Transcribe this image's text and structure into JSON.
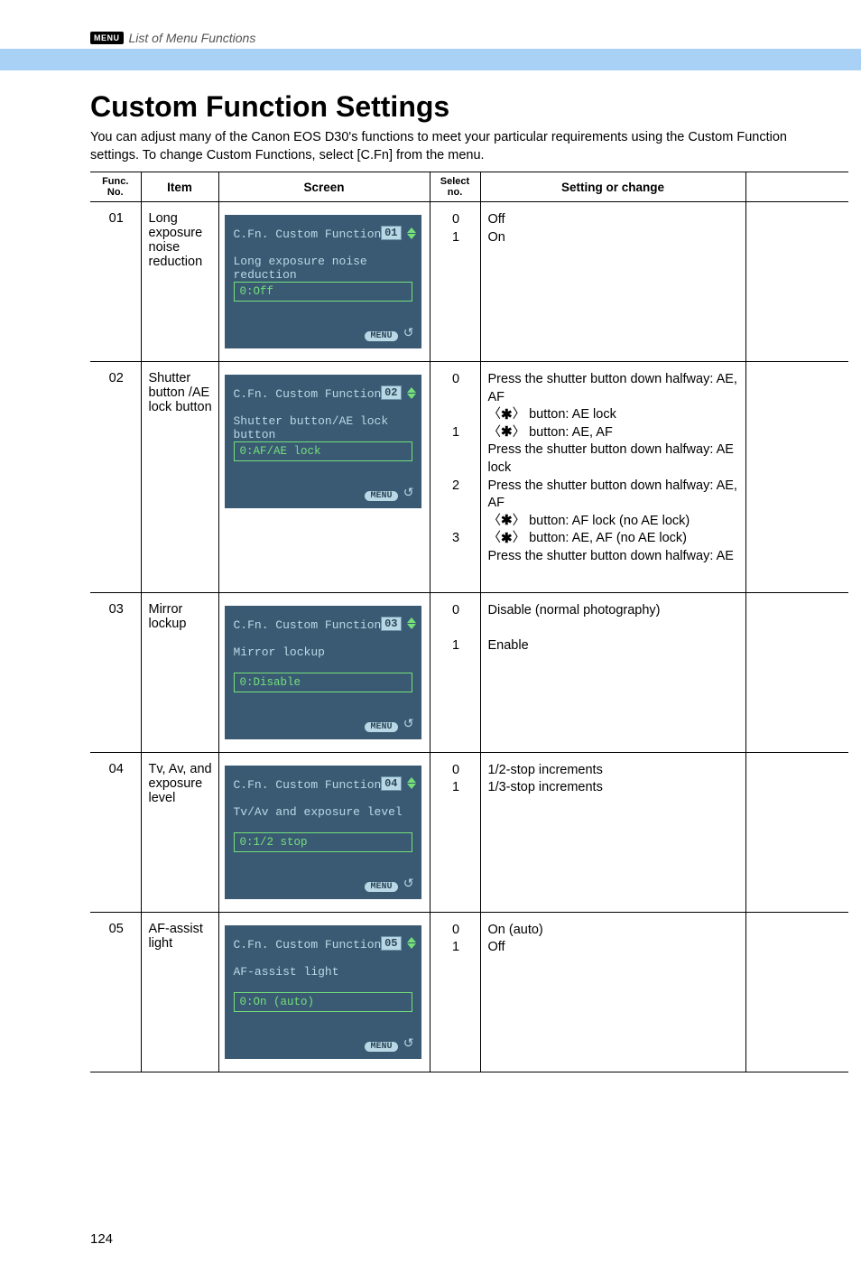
{
  "header": {
    "menu_badge": "MENU",
    "header_label": "List of Menu Functions"
  },
  "title": "Custom Function Settings",
  "intro": "You can adjust many of the Canon EOS D30's functions to meet your particular requirements using the Custom Function settings. To change Custom Functions, select [C.Fn] from the menu.",
  "columns": {
    "func_no": "Func. No.",
    "item": "Item",
    "screen": "Screen",
    "select_no": "Select no.",
    "setting": "Setting or change"
  },
  "lcd_common": {
    "title": "C.Fn. Custom Function",
    "menu": "MENU",
    "back": "↺"
  },
  "rows": [
    {
      "func_no": "01",
      "item": "Long exposure noise reduction",
      "lcd": {
        "num": "01",
        "sub": "Long exposure noise reduction",
        "val": "0:Off"
      },
      "select": "0\n1",
      "setting_plain": "Off\nOn"
    },
    {
      "func_no": "02",
      "item": "Shutter button /AE lock button",
      "lcd": {
        "num": "02",
        "sub": "Shutter button/AE lock button",
        "val": "0:AF/AE lock"
      },
      "select": "0\n\n\n1\n\n\n2\n\n\n3",
      "setting_html": "Press the shutter button down halfway: AE, AF<br>〈<span class='star' data-name='star-icon' data-interactable='false'>✱</span>〉 button: AE lock<br>〈<span class='star' data-name='star-icon' data-interactable='false'>✱</span>〉 button: AE, AF<br>Press the shutter button down halfway: AE lock<br>Press the shutter button down halfway: AE, AF<br>〈<span class='star' data-name='star-icon' data-interactable='false'>✱</span>〉 button: AF lock (no AE lock)<br>〈<span class='star' data-name='star-icon' data-interactable='false'>✱</span>〉 button: AE, AF (no AE lock)<br>Press the shutter button down halfway: AE<br>&nbsp;"
    },
    {
      "func_no": "03",
      "item": "Mirror lockup",
      "lcd": {
        "num": "03",
        "sub": "Mirror lockup",
        "val": "0:Disable"
      },
      "select": "0\n\n1",
      "setting_plain": "Disable (normal photography)\n\nEnable"
    },
    {
      "func_no": "04",
      "item": "Tv, Av, and exposure level",
      "lcd": {
        "num": "04",
        "sub": "Tv/Av and exposure level",
        "val": "0:1/2 stop"
      },
      "select": "0\n1",
      "setting_plain": "1/2-stop increments\n1/3-stop increments"
    },
    {
      "func_no": "05",
      "item": "AF-assist light",
      "lcd": {
        "num": "05",
        "sub": "AF-assist light",
        "val": "0:On (auto)"
      },
      "select": "0\n1",
      "setting_plain": "On (auto)\nOff"
    }
  ],
  "page_number": "124"
}
